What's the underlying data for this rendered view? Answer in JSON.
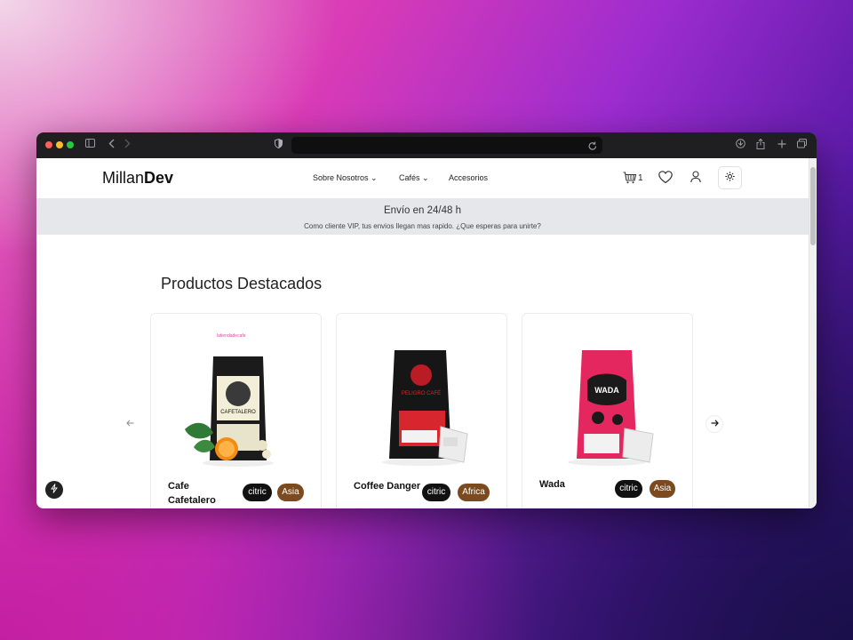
{
  "browser": {
    "icons": [
      "sidebar-icon",
      "back-icon",
      "forward-icon",
      "shield-icon",
      "reload-icon",
      "download-icon",
      "share-icon",
      "new-tab-icon",
      "tabs-icon"
    ]
  },
  "nav": {
    "brand_light": "Millan",
    "brand_bold": "Dev",
    "menu": [
      {
        "label": "Sobre Nosotros ⌄"
      },
      {
        "label": "Cafés ⌄"
      },
      {
        "label": "Accesorios"
      }
    ],
    "cart_count": "1"
  },
  "banner": {
    "title": "Envío en 24/48 h",
    "subtitle": "Como cliente VIP, tus envios llegan mas rapido. ¿Que esperas para unirte?"
  },
  "section_title": "Productos Destacados",
  "products": [
    {
      "name": "Cafe Cafetalero",
      "tags": [
        "citric",
        "Asia"
      ],
      "bag_color": "#1b1b1b",
      "label_color": "#f2eed8",
      "logo_text": "latiendadecafe"
    },
    {
      "name": "Coffee Danger",
      "tags": [
        "citric",
        "Africa"
      ],
      "bag_color": "#161616",
      "label_color": "#d7262e"
    },
    {
      "name": "Wada",
      "tags": [
        "citric",
        "Asia"
      ],
      "bag_color": "#e4275e",
      "label_color": "#1a1a1a"
    }
  ],
  "colors": {
    "tag_citric": "#111111",
    "tag_region": "#7b4a1e",
    "banner_bg": "#e6e7ea"
  }
}
